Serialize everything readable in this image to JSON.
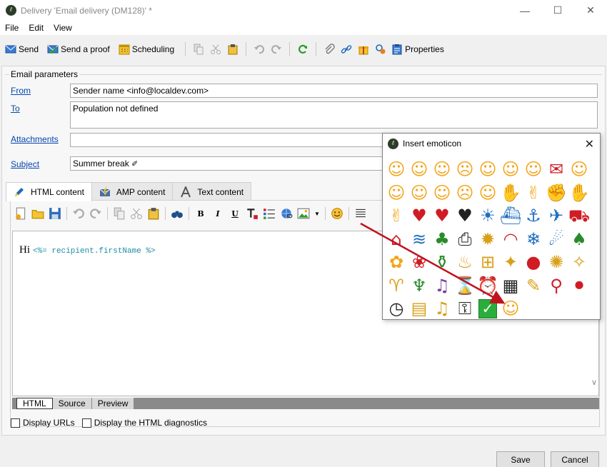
{
  "window": {
    "title": "Delivery 'Email delivery (DM128)' *",
    "minimize": "—",
    "maximize": "☐",
    "close": "✕"
  },
  "menu": [
    "File",
    "Edit",
    "View"
  ],
  "toolbar": {
    "send": "Send",
    "send_proof": "Send a proof",
    "scheduling": "Scheduling",
    "properties": "Properties"
  },
  "email_params": {
    "group_title": "Email parameters",
    "from_label": "From",
    "from_value": "Sender name <info@localdev.com>",
    "to_label": "To",
    "to_value": "Population not defined",
    "attachments_label": "Attachments",
    "attachments_value": "",
    "subject_label": "Subject",
    "subject_value": "Summer break",
    "subject_emoji": "✐"
  },
  "content_tabs": [
    "HTML content",
    "AMP content",
    "Text content"
  ],
  "editor": {
    "text": "Hi",
    "code": "<%= recipient.firstName %>"
  },
  "view_tabs": [
    "HTML",
    "Source",
    "Preview"
  ],
  "options": {
    "display_urls": "Display URLs",
    "display_diagnostics": "Display the HTML diagnostics"
  },
  "buttons": {
    "save": "Save",
    "cancel": "Cancel"
  },
  "emoticon_popup": {
    "title": "Insert emoticon",
    "close": "✕"
  },
  "colors": {
    "link": "#0645ad",
    "code": "#1b8ca6",
    "arrow": "#c1121f",
    "accent_toolbar": "#1e6bb8"
  }
}
